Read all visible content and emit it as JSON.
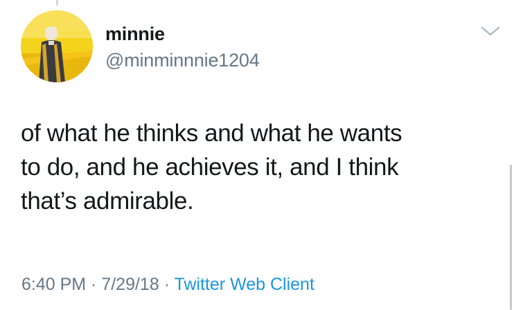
{
  "tweet": {
    "display_name": "minnie",
    "handle": "@minminnnie1204",
    "text_lines": [
      "of what he thinks and what he wants",
      "to do, and he achieves it, and I think",
      "that’s admirable."
    ],
    "time": "6:40 PM",
    "separator_1": " · ",
    "date": "7/29/18",
    "separator_2": " · ",
    "source": "Twitter Web Client"
  },
  "icons": {
    "menu": "chevron-down-icon",
    "avatar": "profile-avatar"
  },
  "colors": {
    "text": "#14171a",
    "secondary": "#657786",
    "link": "#1b95e0",
    "avatar_bg": "#f3d21a"
  }
}
